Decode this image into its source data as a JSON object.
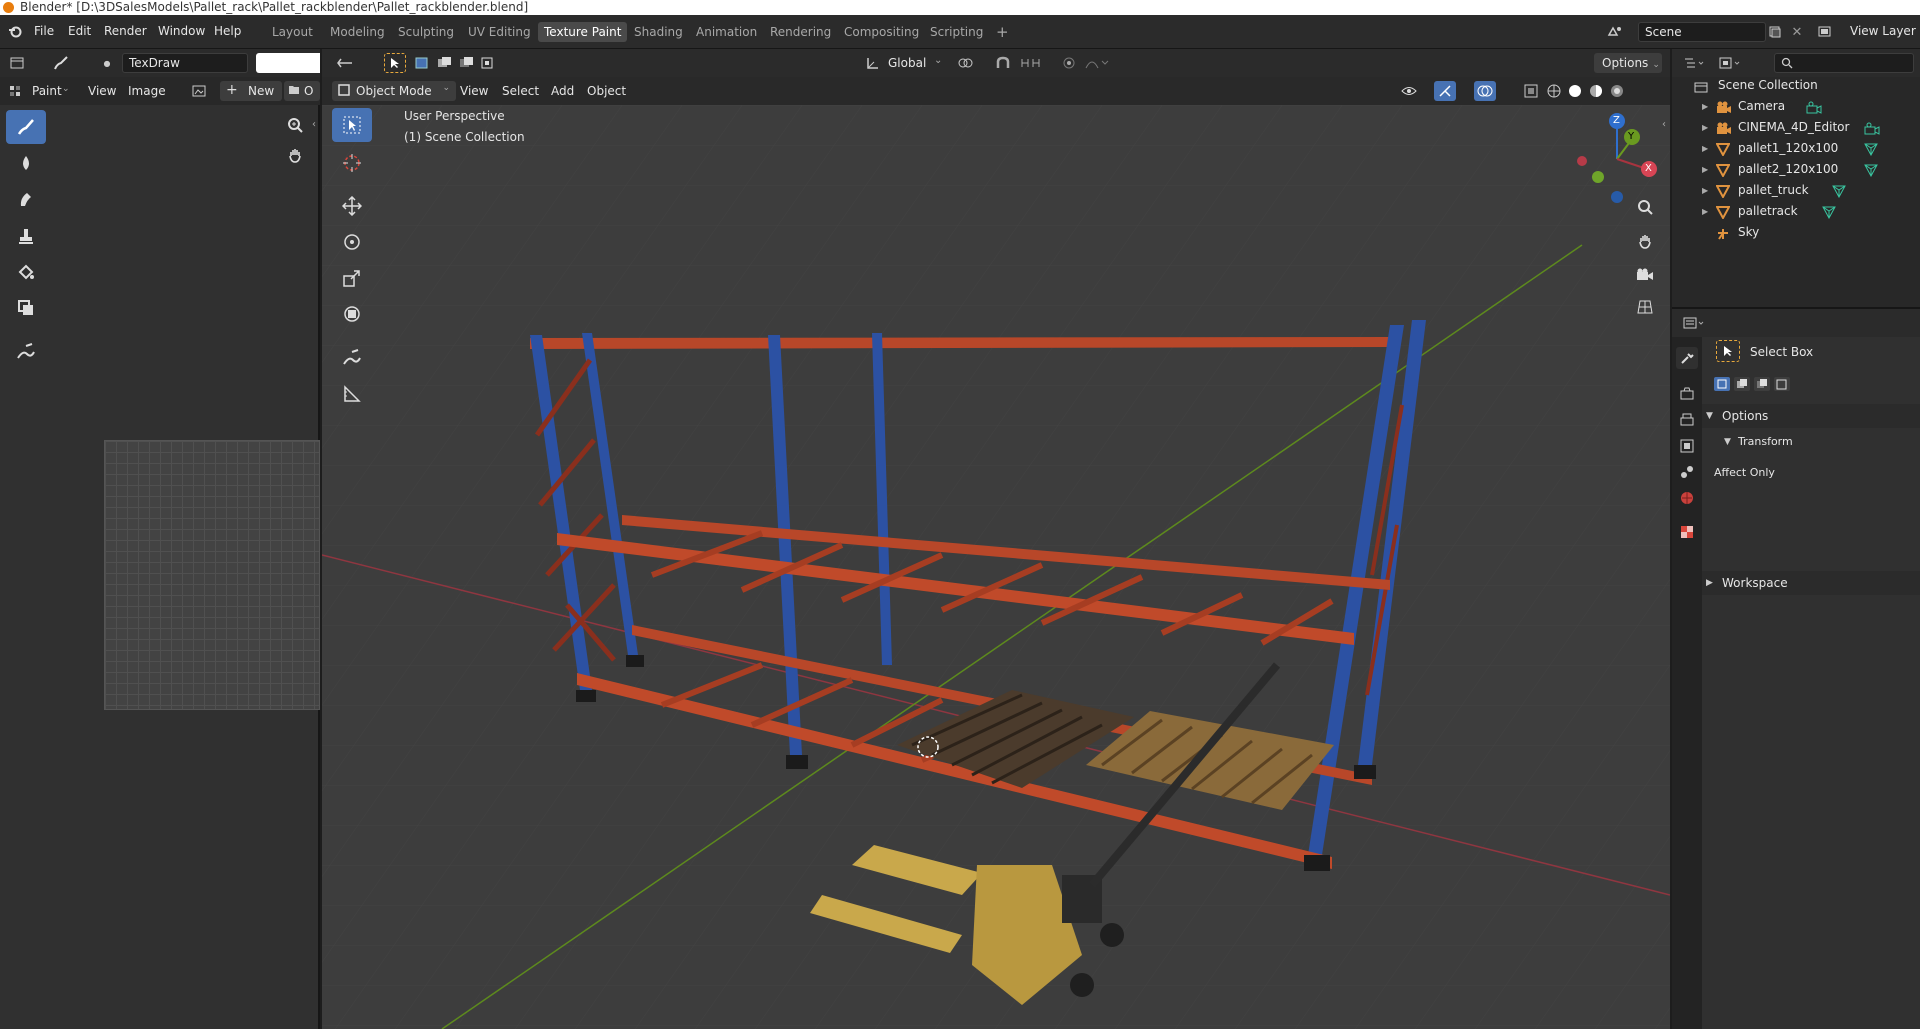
{
  "window_title": "Blender* [D:\\3DSalesModels\\Pallet_rack\\Pallet_rackblender\\Pallet_rackblender.blend]",
  "menu": [
    "File",
    "Edit",
    "Render",
    "Window",
    "Help"
  ],
  "workspaces": [
    "Layout",
    "Modeling",
    "Sculpting",
    "UV Editing",
    "Texture Paint",
    "Shading",
    "Animation",
    "Rendering",
    "Compositing",
    "Scripting"
  ],
  "add_workspace": "+",
  "scene_name": "Scene",
  "view_layer": "View Layer",
  "image_editor": {
    "brush_name": "TexDraw",
    "mode": "Paint",
    "view_menu": "View",
    "image_menu": "Image",
    "new_button": "New",
    "open_button": "O"
  },
  "viewport": {
    "mode": "Object Mode",
    "menus": [
      "View",
      "Select",
      "Add",
      "Object"
    ],
    "orientation": "Global",
    "options": "Options",
    "overlay_line1": "User Perspective",
    "overlay_line2": "(1) Scene Collection",
    "gizmo_axes": {
      "z": "Z",
      "y": "Y",
      "x": "X"
    },
    "colors": {
      "x_axis": "#a8343f",
      "y_axis": "#6a9a20",
      "z_axis": "#2f6fce",
      "rack_upright": "#2b4fa0",
      "rack_beam": "#c04a2a",
      "pallet_truck": "#c9a84b"
    }
  },
  "outliner": {
    "root": "Scene Collection",
    "items": [
      {
        "name": "Camera",
        "icon": "camera-icon"
      },
      {
        "name": "CINEMA_4D_Editor",
        "icon": "camera-icon"
      },
      {
        "name": "pallet1_120x100",
        "icon": "mesh-icon"
      },
      {
        "name": "pallet2_120x100",
        "icon": "mesh-icon"
      },
      {
        "name": "pallet_truck",
        "icon": "mesh-icon"
      },
      {
        "name": "palletrack",
        "icon": "mesh-icon"
      },
      {
        "name": "Sky",
        "icon": "light-icon"
      }
    ]
  },
  "properties": {
    "tool_name": "Select Box",
    "options_label": "Options",
    "transform_label": "Transform",
    "affect_only": "Affect Only",
    "workspace_label": "Workspace"
  }
}
